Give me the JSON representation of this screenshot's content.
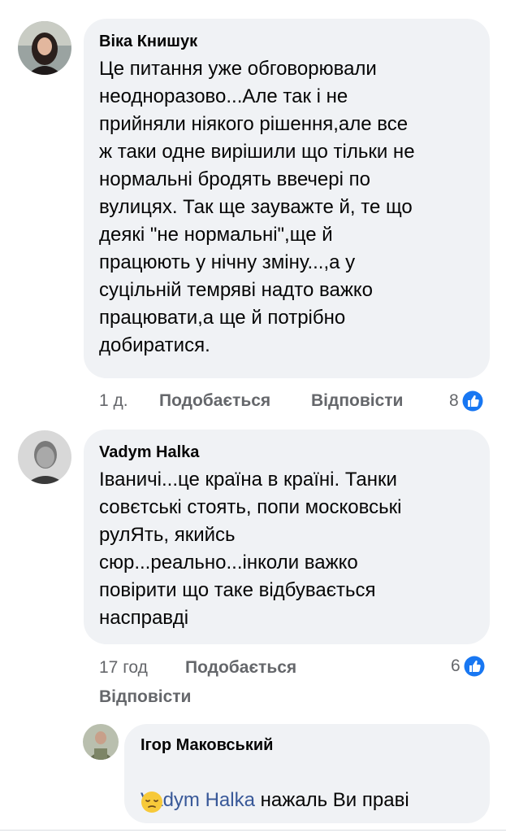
{
  "comments": [
    {
      "author": "Віка Книшук",
      "text": "Це питання уже обговорювали\nнеодноразово...Але так і не\nприйняли ніякого рішення,але все\nж таки одне вирішили що тільки не\nнормальні бродять  ввечері по\nвулицях. Так ще зауважте й, те що\nдеякі \"не нормальні\",ще й\nпрацюють у нічну зміну...,а у\nсуцільній темряві надто важко\nпрацювати,а ще й потрібно\nдобиратися.",
      "time": "1 д.",
      "like_label": "Подобається",
      "reply_label": "Відповісти",
      "reaction_count": "8",
      "reaction_icon": "like-icon"
    },
    {
      "author": "Vadym Halka",
      "text": "Іваничі...це країна в країні. Танки\nсовєтські стоять, попи московські\nрулЯть, якийсь\nсюр...реально...інколи важко\nповірити що таке відбувається\nнасправді",
      "time": "17 год",
      "like_label": "Подобається",
      "reply_label": "Відповісти",
      "reaction_count": "6",
      "reaction_icon": "like-icon"
    }
  ],
  "reply": {
    "author": "Ігор Маковський",
    "mention": "Vadym Halka",
    "text": " нажаль Ви праві",
    "emoji": "pensive-face-emoji"
  },
  "colors": {
    "bubble": "#f0f2f5",
    "meta_text": "#65676b",
    "like_blue": "#1877f2",
    "mention": "#385898"
  }
}
